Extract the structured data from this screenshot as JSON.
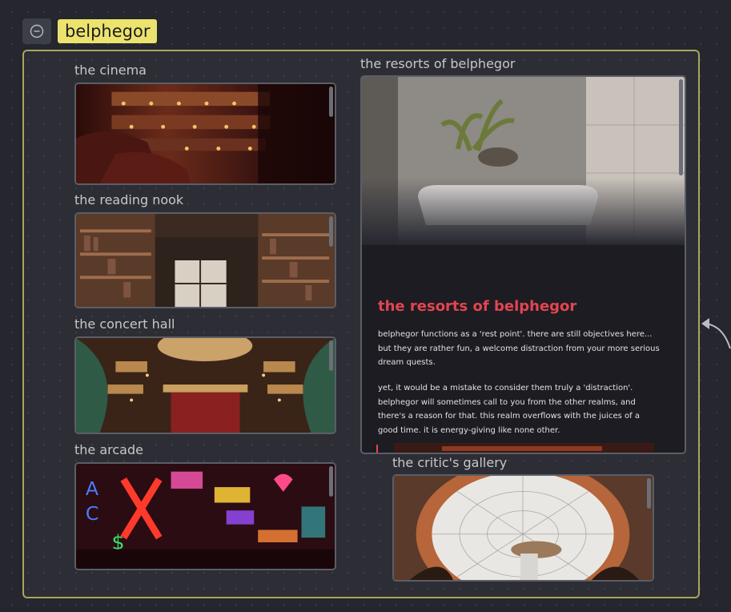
{
  "group": {
    "title": "belphegor",
    "collapse_icon": "minus-circle-icon"
  },
  "colors": {
    "canvas_bg": "#25262e",
    "group_border": "#a8a65b",
    "group_label_bg": "#ebe36e",
    "heading_accent": "#e2454f",
    "node_border": "#5b5e66"
  },
  "nodes": [
    {
      "id": "cinema",
      "label": "the cinema",
      "image": "theater-balcony-image"
    },
    {
      "id": "reading-nook",
      "label": "the reading nook",
      "image": "library-bookshelves-image"
    },
    {
      "id": "concert-hall",
      "label": "the concert hall",
      "image": "ornate-concert-hall-image"
    },
    {
      "id": "arcade",
      "label": "the arcade",
      "image": "neon-signs-arcade-image"
    },
    {
      "id": "critics-gallery",
      "label": "the critic's gallery",
      "image": "glass-dome-image"
    }
  ],
  "resorts": {
    "label": "the resorts of belphegor",
    "image": "bathtub-plant-image",
    "heading": "the resorts of belphegor",
    "paragraphs": [
      "belphegor functions as a 'rest point'. there are still objectives here... but they are rather fun, a welcome distraction from your more serious dream quests.",
      "yet, it would be a mistake to consider them truly a 'distraction'. belphegor will sometimes call to you from the other realms, and there's a reason for that. this realm overflows with the juices of a good time. it is energy-giving like none other."
    ]
  },
  "edge_icon": "arrow-left-icon"
}
